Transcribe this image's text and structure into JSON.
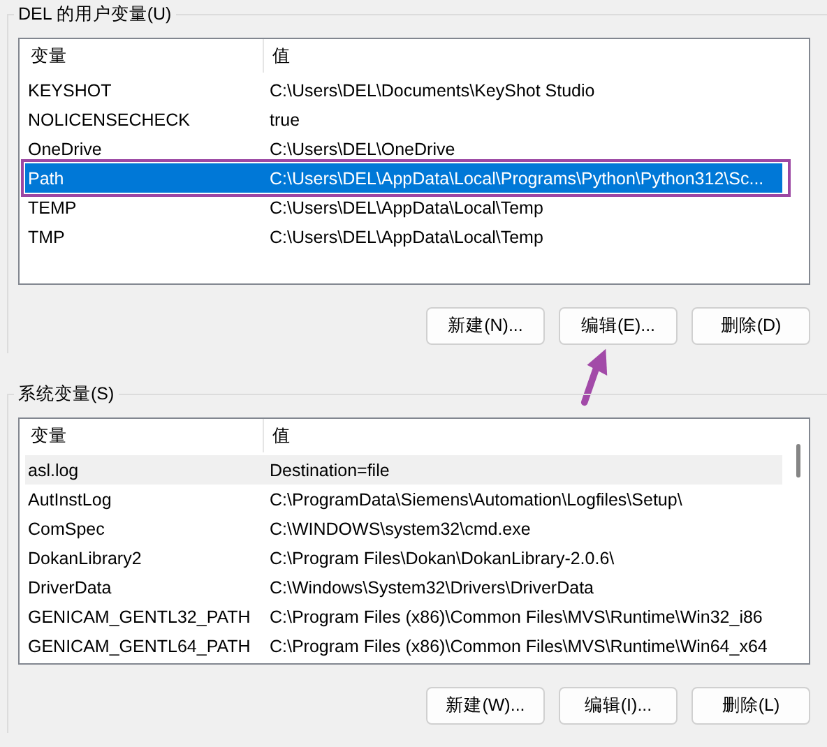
{
  "groups": [
    {
      "title": "DEL 的用户变量(U)",
      "list_focused": true,
      "columns": [
        "变量",
        "值"
      ],
      "rows": [
        {
          "name": "KEYSHOT",
          "value": "C:\\Users\\DEL\\Documents\\KeyShot Studio",
          "selected": false
        },
        {
          "name": "NOLICENSECHECK",
          "value": "true",
          "selected": false
        },
        {
          "name": "OneDrive",
          "value": "C:\\Users\\DEL\\OneDrive",
          "selected": false
        },
        {
          "name": "Path",
          "value": "C:\\Users\\DEL\\AppData\\Local\\Programs\\Python\\Python312\\Sc...",
          "selected": true
        },
        {
          "name": "TEMP",
          "value": "C:\\Users\\DEL\\AppData\\Local\\Temp",
          "selected": false
        },
        {
          "name": "TMP",
          "value": "C:\\Users\\DEL\\AppData\\Local\\Temp",
          "selected": false
        }
      ],
      "buttons": [
        "新建(N)...",
        "编辑(E)...",
        "删除(D)"
      ]
    },
    {
      "title": "系统变量(S)",
      "list_focused": false,
      "columns": [
        "变量",
        "值"
      ],
      "rows": [
        {
          "name": "asl.log",
          "value": "Destination=file",
          "selected": true
        },
        {
          "name": "AutInstLog",
          "value": "C:\\ProgramData\\Siemens\\Automation\\Logfiles\\Setup\\",
          "selected": false
        },
        {
          "name": "ComSpec",
          "value": "C:\\WINDOWS\\system32\\cmd.exe",
          "selected": false
        },
        {
          "name": "DokanLibrary2",
          "value": "C:\\Program Files\\Dokan\\DokanLibrary-2.0.6\\",
          "selected": false
        },
        {
          "name": "DriverData",
          "value": "C:\\Windows\\System32\\Drivers\\DriverData",
          "selected": false
        },
        {
          "name": "GENICAM_GENTL32_PATH",
          "value": "C:\\Program Files (x86)\\Common Files\\MVS\\Runtime\\Win32_i86",
          "selected": false
        },
        {
          "name": "GENICAM_GENTL64_PATH",
          "value": "C:\\Program Files (x86)\\Common Files\\MVS\\Runtime\\Win64_x64",
          "selected": false
        }
      ],
      "buttons": [
        "新建(W)...",
        "编辑(I)...",
        "删除(L)"
      ]
    }
  ],
  "annotation": {
    "highlight_box": true,
    "arrow": true
  }
}
